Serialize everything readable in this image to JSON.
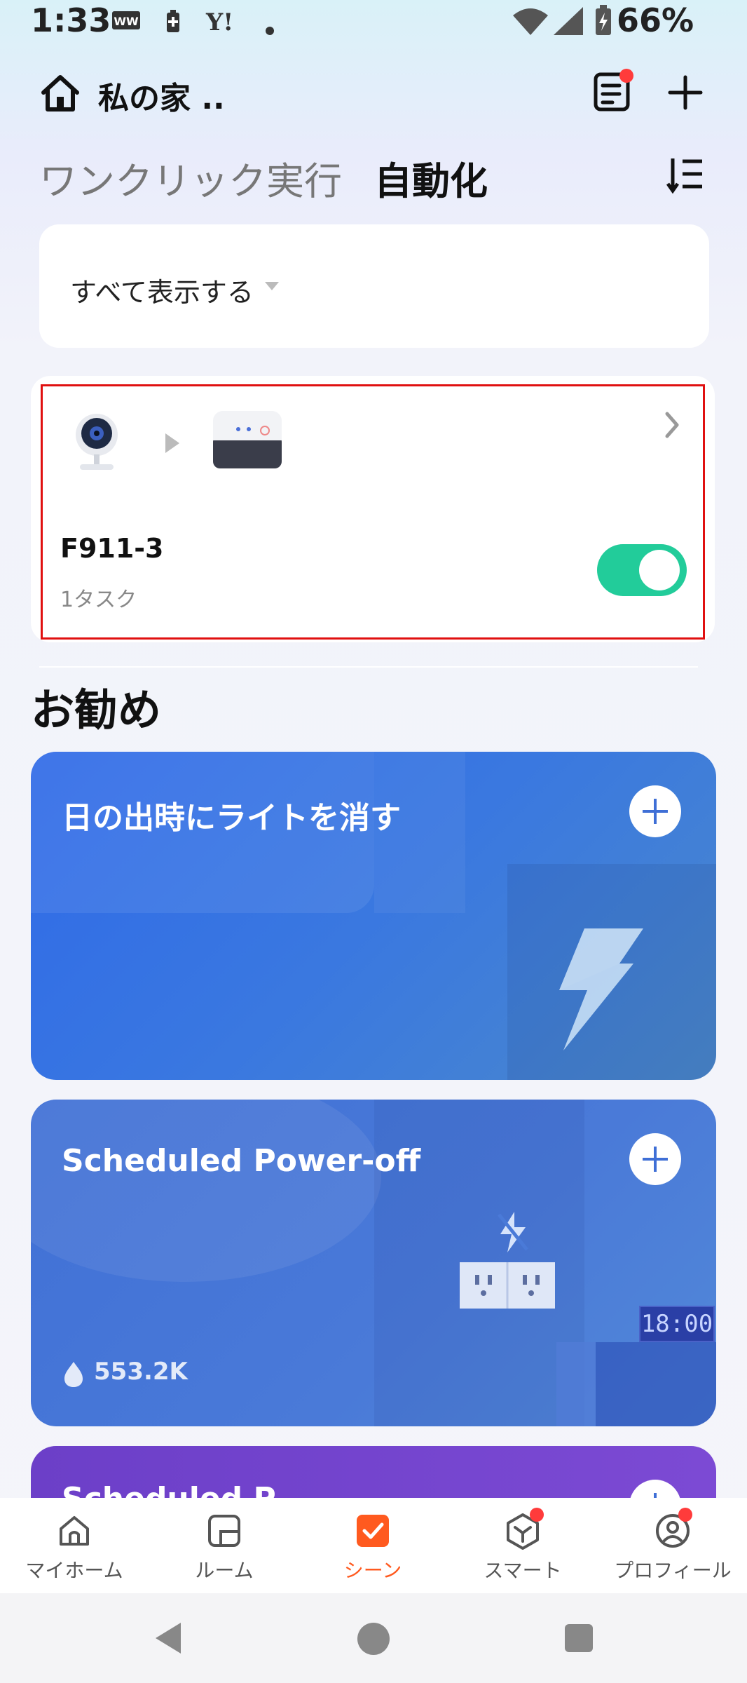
{
  "status_bar": {
    "time": "1:33",
    "battery": "66%",
    "icons": [
      "ww-icon",
      "battery-saver-icon",
      "yahoo-icon",
      "dot-icon",
      "wifi-icon",
      "signal-icon",
      "battery-charging-icon"
    ]
  },
  "header": {
    "home_name": "私の家 ..",
    "icons": [
      "home-icon",
      "notes-icon",
      "plus-icon"
    ]
  },
  "tabs": {
    "one_click": "ワンクリック実行",
    "automation": "自動化"
  },
  "filter": {
    "label": "すべて表示する"
  },
  "automation_card": {
    "name": "F911-3",
    "subtitle": "1タスク",
    "enabled": true,
    "devices": [
      "camera-device-icon",
      "hub-device-icon"
    ]
  },
  "recommended": {
    "title": "お勧め",
    "cards": [
      {
        "title": "日の出時にライトを消す",
        "accent": "#2f6ae8"
      },
      {
        "title": "Scheduled Power-off",
        "stat": "553.2K",
        "clock": "18:00",
        "accent": "#4a7ad8"
      },
      {
        "title": "Scheduled P...",
        "accent": "#7c4ad4"
      }
    ]
  },
  "bottom_nav": {
    "items": [
      {
        "label": "マイホーム",
        "icon": "home-outline-icon",
        "active": false,
        "badge": false
      },
      {
        "label": "ルーム",
        "icon": "room-icon",
        "active": false,
        "badge": false
      },
      {
        "label": "シーン",
        "icon": "scene-check-icon",
        "active": true,
        "badge": false
      },
      {
        "label": "スマート",
        "icon": "smart-cube-icon",
        "active": false,
        "badge": true
      },
      {
        "label": "プロフィール",
        "icon": "profile-icon",
        "active": false,
        "badge": true
      }
    ]
  },
  "colors": {
    "toggle_on": "#22cc9a",
    "active_tab": "#ff5a1f",
    "highlight_border": "#e01010",
    "badge": "#ff3b3b"
  }
}
